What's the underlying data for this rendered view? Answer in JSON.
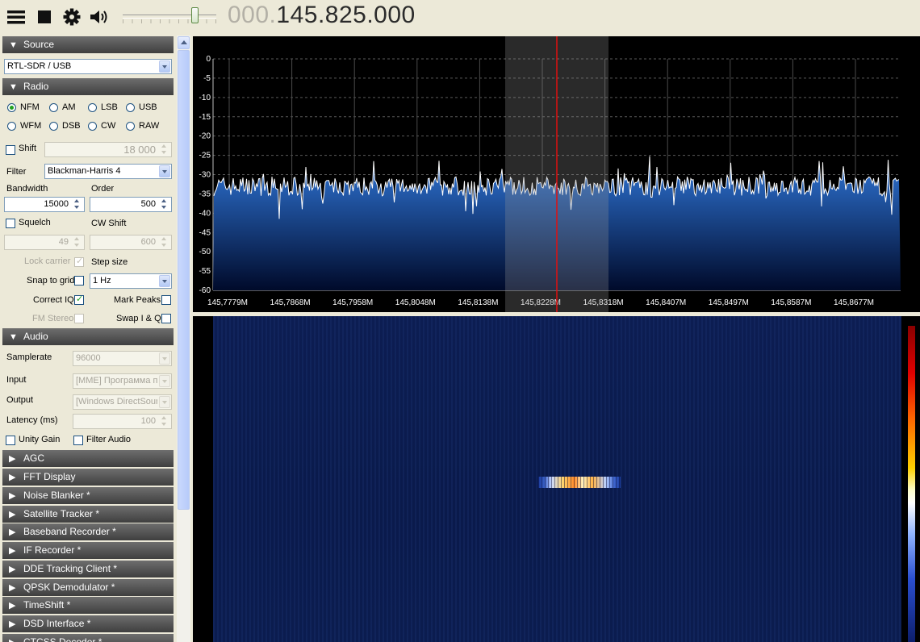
{
  "toolbar": {
    "icons": [
      "menu-icon",
      "stop-icon",
      "gear-icon",
      "speaker-icon"
    ],
    "volume_level": 0.78,
    "frequency_dim": "000.",
    "frequency_main": "145.825.000"
  },
  "source": {
    "title": "Source",
    "device": "RTL-SDR / USB"
  },
  "radio": {
    "title": "Radio",
    "modes_row1": [
      "NFM",
      "AM",
      "LSB",
      "USB"
    ],
    "modes_row2": [
      "WFM",
      "DSB",
      "CW",
      "RAW"
    ],
    "selected_mode": "NFM",
    "shift_label": "Shift",
    "shift_value": "18 000",
    "filter_label": "Filter",
    "filter_value": "Blackman-Harris 4",
    "bandwidth_label": "Bandwidth",
    "bandwidth_value": "15000",
    "order_label": "Order",
    "order_value": "500",
    "squelch_label": "Squelch",
    "squelch_value": "49",
    "cwshift_label": "CW Shift",
    "cwshift_value": "600",
    "lock_carrier_label": "Lock carrier",
    "step_size_label": "Step size",
    "snap_label": "Snap to grid",
    "step_value": "1 Hz",
    "correct_iq_label": "Correct IQ",
    "mark_peaks_label": "Mark Peaks",
    "fm_stereo_label": "FM Stereo",
    "swap_iq_label": "Swap I & Q"
  },
  "audio": {
    "title": "Audio",
    "samplerate_label": "Samplerate",
    "samplerate_value": "96000",
    "input_label": "Input",
    "input_value": "[MME] Программа пе",
    "output_label": "Output",
    "output_value": "[Windows DirectSound",
    "latency_label": "Latency (ms)",
    "latency_value": "100",
    "unity_gain_label": "Unity Gain",
    "filter_audio_label": "Filter Audio"
  },
  "collapsed_sections": [
    "AGC",
    "FFT Display",
    "Noise Blanker *",
    "Satellite Tracker *",
    "Baseband Recorder *",
    "IF Recorder *",
    "DDE Tracking Client *",
    "QPSK Demodulator *",
    "TimeShift *",
    "DSD Interface *",
    "CTCSS Decoder *"
  ],
  "spectrum": {
    "y_ticks": [
      "0",
      "-5",
      "-10",
      "-15",
      "-20",
      "-25",
      "-30",
      "-35",
      "-40",
      "-45",
      "-50",
      "-55",
      "-60"
    ],
    "x_ticks": [
      "145,7779M",
      "145,7868M",
      "145,7958M",
      "145,8048M",
      "145,8138M",
      "145,8228M",
      "145,8318M",
      "145,8407M",
      "145,8497M",
      "145,8587M",
      "145,8677M"
    ],
    "noise_floor_db": -33,
    "colors": {
      "fill_top": "#2f76d8",
      "fill_bottom": "#000a2a",
      "trace": "#ffffff",
      "tuning_line": "#e01010"
    }
  }
}
